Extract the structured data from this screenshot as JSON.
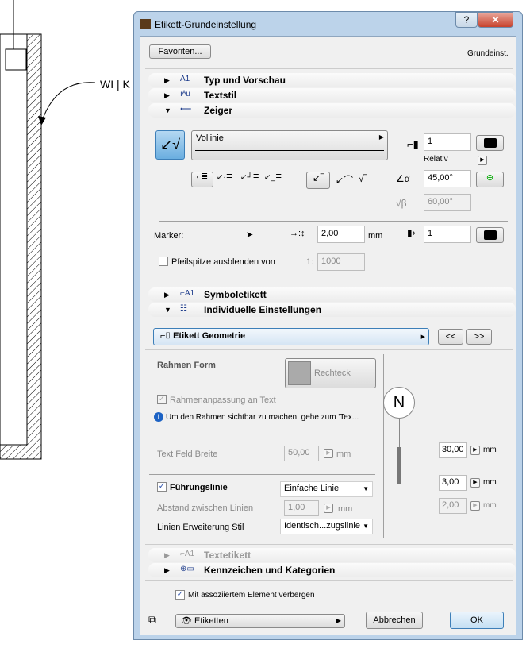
{
  "background": {
    "plan_label": "WI | K"
  },
  "dialog": {
    "title": "Etikett-Grundeinstellung",
    "help": "?",
    "close": "✕",
    "favorites": "Favoriten...",
    "preset": "Grundeinst.",
    "sections": {
      "typ": "Typ und Vorschau",
      "textstil": "Textstil",
      "zeiger": "Zeiger",
      "symbol": "Symboletikett",
      "individuell": "Individuelle Einstellungen",
      "textetikett": "Textetikett",
      "kennzeichen": "Kennzeichen und Kategorien"
    },
    "zeiger": {
      "line_type": "Vollinie",
      "pen": "1",
      "relativ": "Relativ",
      "angle": "45,00°",
      "angle2": "60,00°",
      "marker_label": "Marker:",
      "marker_size": "2,00",
      "marker_unit": "mm",
      "marker_pen": "1",
      "hide_arrow_label": "Pfeilspitze ausblenden von",
      "scale_prefix": "1:",
      "scale": "1000"
    },
    "individuell": {
      "geometry_button": "Etikett Geometrie",
      "prev": "<<",
      "next": ">>",
      "frame_label": "Rahmen Form",
      "frame_value": "Rechteck",
      "fit_label": "Rahmenanpassung an Text",
      "info": "Um den Rahmen sichtbar zu machen, gehe zum 'Tex...",
      "width_label": "Text Feld Breite",
      "width_value": "50,00",
      "width_unit": "mm",
      "leader_label": "Führungslinie",
      "leader_value": "Einfache Linie",
      "spacing_label": "Abstand zwischen Linien",
      "spacing_value": "1,00",
      "spacing_unit": "mm",
      "ext_label": "Linien Erweiterung Stil",
      "ext_value": "Identisch...zugslinie",
      "preview_letter": "N",
      "dim1": "30,00",
      "dim2": "3,00",
      "dim3": "2,00",
      "unit": "mm"
    },
    "hide_with_element": "Mit assoziiertem Element verbergen",
    "layer": "Etiketten",
    "cancel": "Abbrechen",
    "ok": "OK"
  }
}
